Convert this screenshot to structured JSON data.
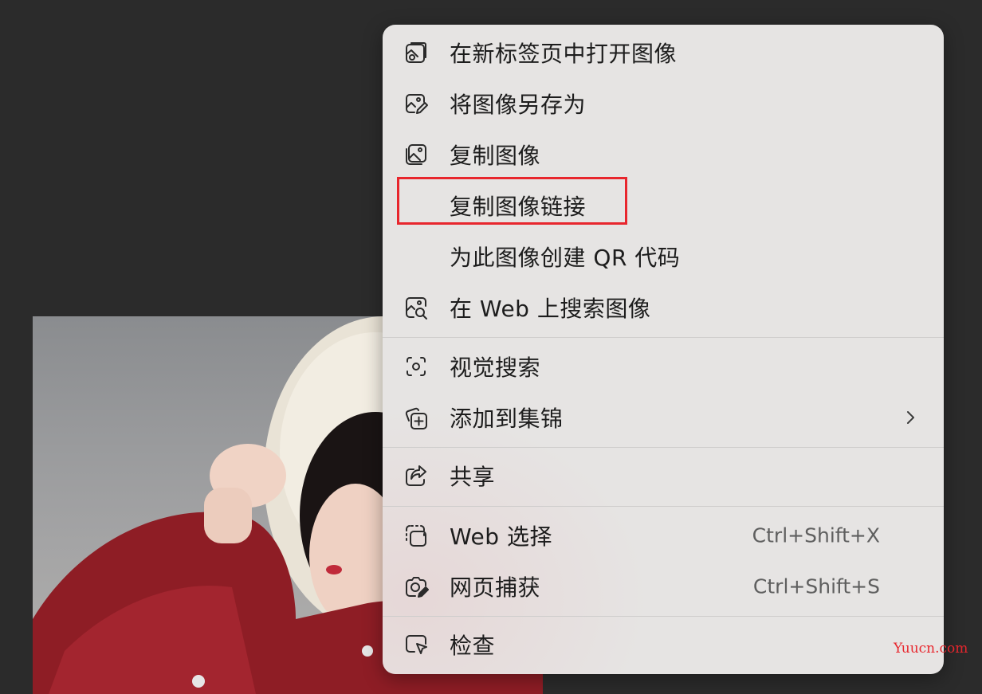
{
  "context_menu": {
    "items": [
      {
        "label": "在新标签页中打开图像",
        "icon": "open-image-new-tab-icon"
      },
      {
        "label": "将图像另存为",
        "icon": "save-image-icon"
      },
      {
        "label": "复制图像",
        "icon": "copy-image-icon"
      },
      {
        "label": "复制图像链接",
        "icon": ""
      },
      {
        "label": "为此图像创建 QR 代码",
        "icon": ""
      },
      {
        "label": "在 Web 上搜索图像",
        "icon": "image-search-icon"
      },
      {
        "label": "视觉搜索",
        "icon": "visual-search-icon"
      },
      {
        "label": "添加到集锦",
        "icon": "add-to-collections-icon",
        "submenu": true
      },
      {
        "label": "共享",
        "icon": "share-icon"
      },
      {
        "label": "Web 选择",
        "icon": "web-select-icon",
        "shortcut": "Ctrl+Shift+X"
      },
      {
        "label": "网页捕获",
        "icon": "web-capture-icon",
        "shortcut": "Ctrl+Shift+S"
      },
      {
        "label": "检查",
        "icon": "inspect-icon"
      }
    ],
    "highlighted_item": "复制图像链接"
  },
  "colors": {
    "background": "#2b2b2b",
    "menu_background": "#e6e4e3",
    "highlight_border": "#e8262d",
    "text": "#1d1d1d",
    "shortcut_text": "#5f5f5f"
  },
  "watermark": "Yuucn.com"
}
